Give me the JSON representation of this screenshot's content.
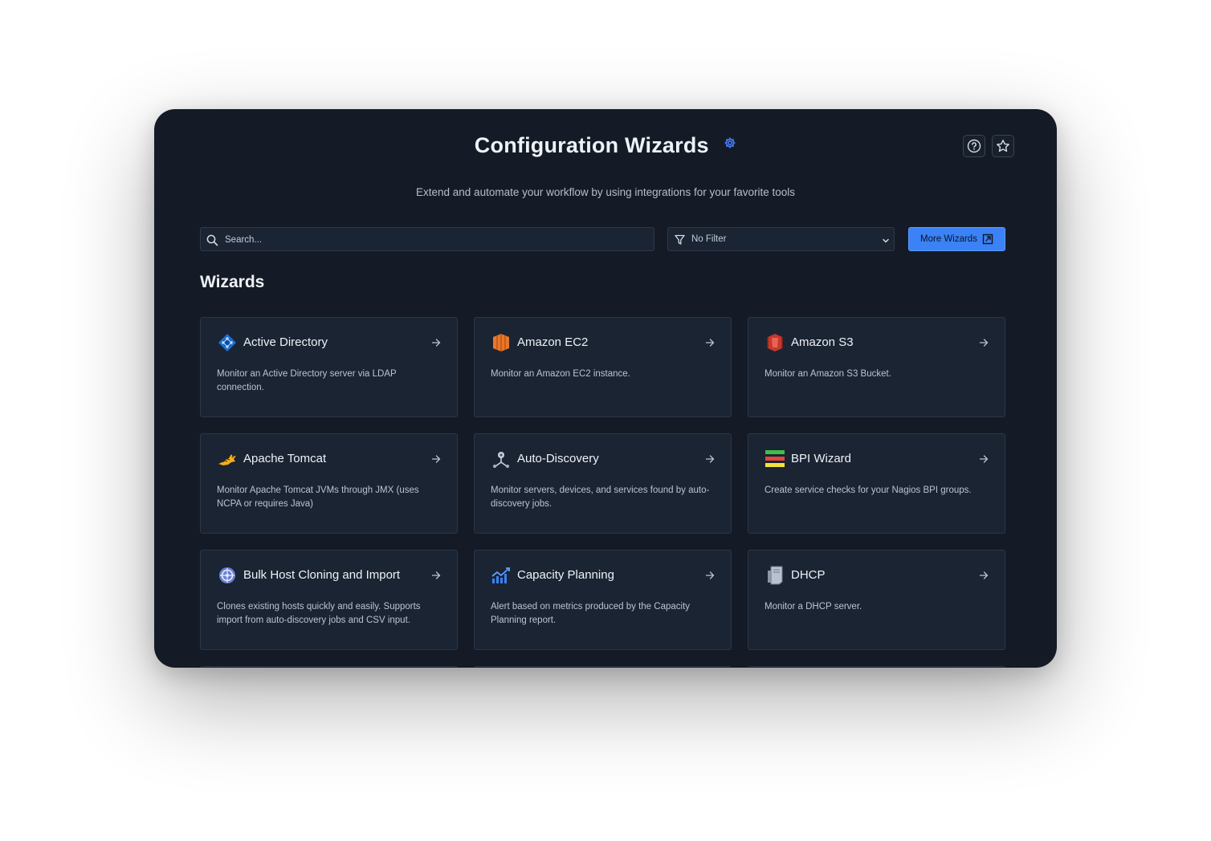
{
  "header": {
    "title": "Configuration Wizards",
    "title_icon": "gear-icon",
    "subtitle": "Extend and automate your workflow by using integrations for your favorite tools",
    "actions": [
      {
        "name": "help-button",
        "icon": "question-circle-icon"
      },
      {
        "name": "favorite-button",
        "icon": "star-icon"
      }
    ]
  },
  "toolbar": {
    "search_placeholder": "Search...",
    "filter_label": "No Filter",
    "more_wizards_label": "More Wizards"
  },
  "section_title": "Wizards",
  "wizards": [
    {
      "title": "Active Directory",
      "desc": "Monitor an Active Directory server via LDAP connection.",
      "icon": "active-directory-icon"
    },
    {
      "title": "Amazon EC2",
      "desc": "Monitor an Amazon EC2 instance.",
      "icon": "amazon-ec2-icon"
    },
    {
      "title": "Amazon S3",
      "desc": "Monitor an Amazon S3 Bucket.",
      "icon": "amazon-s3-icon"
    },
    {
      "title": "Apache Tomcat",
      "desc": "Monitor Apache Tomcat JVMs through JMX (uses NCPA or requires Java)",
      "icon": "apache-tomcat-icon"
    },
    {
      "title": "Auto-Discovery",
      "desc": "Monitor servers, devices, and services found by auto-discovery jobs.",
      "icon": "auto-discovery-icon"
    },
    {
      "title": "BPI Wizard",
      "desc": "Create service checks for your Nagios BPI groups.",
      "icon": "bpi-icon"
    },
    {
      "title": "Bulk Host Cloning and Import",
      "desc": "Clones existing hosts quickly and easily. Supports import from auto-discovery jobs and CSV input.",
      "icon": "bulk-host-icon"
    },
    {
      "title": "Capacity Planning",
      "desc": "Alert based on metrics produced by the Capacity Planning report.",
      "icon": "capacity-planning-icon"
    },
    {
      "title": "DHCP",
      "desc": "Monitor a DHCP server.",
      "icon": "dhcp-server-icon"
    }
  ],
  "colors": {
    "background": "#141b26",
    "card": "#1b2433",
    "accent": "#3b82f6"
  }
}
